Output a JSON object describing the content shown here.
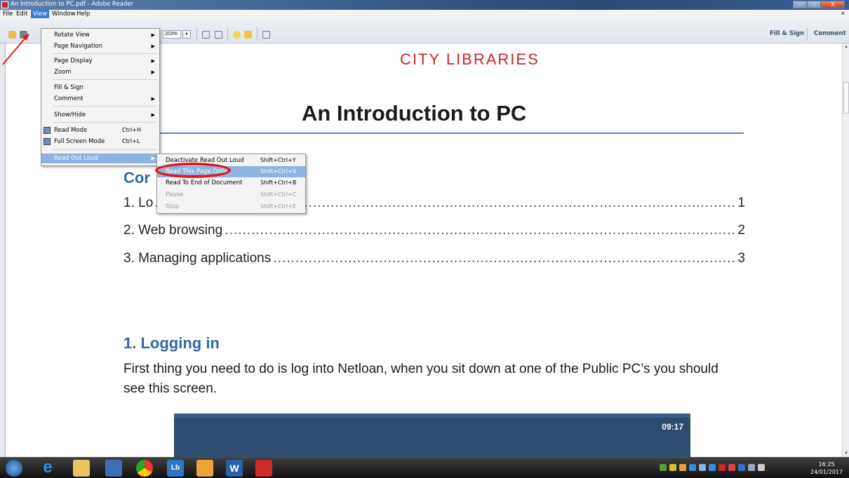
{
  "window": {
    "title": "An Introduction to PC.pdf - Adobe Reader",
    "minimize": "–",
    "maximize": "□",
    "close": "X",
    "doc_close": "×"
  },
  "menubar": {
    "items": [
      "File",
      "Edit",
      "View",
      "Window",
      "Help"
    ],
    "active": "View"
  },
  "toolbar": {
    "zoom_value": "203%",
    "fill_sign": "Fill & Sign",
    "comment": "Comment"
  },
  "view_menu": {
    "items": [
      {
        "label": "Rotate View",
        "submenu": true
      },
      {
        "label": "Page Navigation",
        "submenu": true
      },
      {
        "label": "Page Display",
        "submenu": true
      },
      {
        "label": "Zoom",
        "submenu": true
      },
      {
        "label": "Fill & Sign"
      },
      {
        "label": "Comment",
        "submenu": true
      },
      {
        "label": "Show/Hide",
        "submenu": true
      },
      {
        "label": "Read Mode",
        "shortcut": "Ctrl+H"
      },
      {
        "label": "Full Screen Mode",
        "shortcut": "Ctrl+L"
      },
      {
        "label": "Read Out Loud",
        "submenu": true,
        "highlighted": true
      }
    ]
  },
  "read_out_loud_menu": {
    "items": [
      {
        "label": "Deactivate Read Out Loud",
        "shortcut": "Shift+Ctrl+Y"
      },
      {
        "label": "Read This Page Only",
        "shortcut": "Shift+Ctrl+V",
        "highlighted": true
      },
      {
        "label": "Read To End of Document",
        "shortcut": "Shift+Ctrl+B"
      },
      {
        "label": "Pause",
        "shortcut": "Shift+Ctrl+C",
        "disabled": true
      },
      {
        "label": "Stop",
        "shortcut": "Shift+Ctrl+E",
        "disabled": true
      }
    ]
  },
  "document": {
    "library": "CITY LIBRARIES",
    "title": "An Introduction to PC",
    "contents_heading": "Cor",
    "toc": [
      {
        "label": "1. Lo",
        "page": "1"
      },
      {
        "label": "2. Web browsing",
        "page": "2"
      },
      {
        "label": "3. Managing applications",
        "page": "3"
      }
    ],
    "dots": "..................................................................................................................................................",
    "section1_heading": "1. Logging in",
    "section1_text": "First thing you need to do is log into Netloan, when you sit down at one of the Public PC’s you should see this screen.",
    "netloan_time": "09:17"
  },
  "taskbar": {
    "clock_time": "16:25",
    "clock_date": "24/01/2017",
    "w_label": "W",
    "lync_label": "Lb"
  },
  "colors": {
    "accent": "#c8262a",
    "heading_blue": "#34679e",
    "menu_highlight": "#8fb2df"
  }
}
